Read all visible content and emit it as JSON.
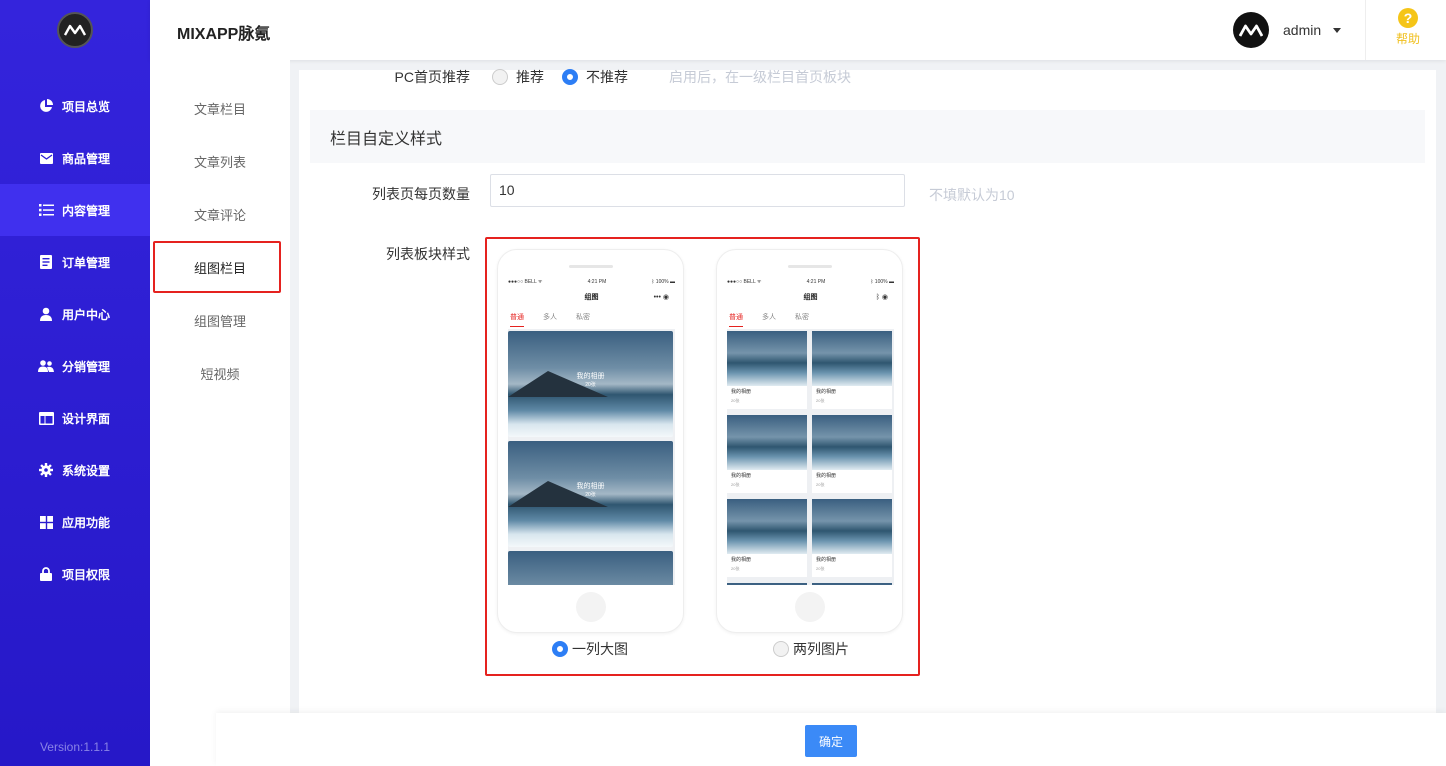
{
  "sidebar": {
    "items": [
      {
        "label": "项目总览",
        "icon": "pie-chart-icon"
      },
      {
        "label": "商品管理",
        "icon": "envelope-icon"
      },
      {
        "label": "内容管理",
        "icon": "list-icon"
      },
      {
        "label": "订单管理",
        "icon": "document-icon"
      },
      {
        "label": "用户中心",
        "icon": "user-icon"
      },
      {
        "label": "分销管理",
        "icon": "users-icon"
      },
      {
        "label": "设计界面",
        "icon": "layout-icon"
      },
      {
        "label": "系统设置",
        "icon": "gear-icon"
      },
      {
        "label": "应用功能",
        "icon": "grid-icon"
      },
      {
        "label": "项目权限",
        "icon": "lock-icon"
      }
    ],
    "active_index": 2,
    "version": "Version:1.1.1"
  },
  "header": {
    "title": "MIXAPP脉氪",
    "username": "admin",
    "help_label": "帮助"
  },
  "submenu": {
    "items": [
      "文章栏目",
      "文章列表",
      "文章评论",
      "组图栏目",
      "组图管理",
      "短视频"
    ],
    "active_index": 3
  },
  "form": {
    "pc_recommend": {
      "label": "PC首页推荐",
      "options": [
        "推荐",
        "不推荐"
      ],
      "selected": "不推荐",
      "hint": "启用后，在一级栏目首页板块"
    },
    "section_title": "栏目自定义样式",
    "page_size": {
      "label": "列表页每页数量",
      "value": "10",
      "hint": "不填默认为10"
    },
    "list_style": {
      "label": "列表板块样式",
      "options": [
        "一列大图",
        "两列图片"
      ],
      "selected": "一列大图"
    },
    "confirm_label": "确定"
  },
  "phone_preview": {
    "status_left": "●●●○○ BELL ᯤ",
    "status_time": "4:21 PM",
    "status_right": "ᛒ 100% ▬",
    "title": "组图",
    "tabs": [
      "普通",
      "多人",
      "私密"
    ],
    "active_tab": "普通",
    "big_card_title": "我的相册",
    "big_card_count": "20张",
    "small_cards": [
      {
        "title": "我的相册",
        "count": "20张"
      },
      {
        "title": "我的相册",
        "count": "20张"
      },
      {
        "title": "我的相册",
        "count": "20张"
      },
      {
        "title": "我的相册",
        "count": "20张"
      },
      {
        "title": "我的相册",
        "count": "20张"
      },
      {
        "title": "我的相册",
        "count": "20张"
      }
    ]
  },
  "colors": {
    "sidebar": "#2a1ed6",
    "accent": "#3b8af7",
    "highlight_border": "#e5221f",
    "help": "#f5c518"
  }
}
